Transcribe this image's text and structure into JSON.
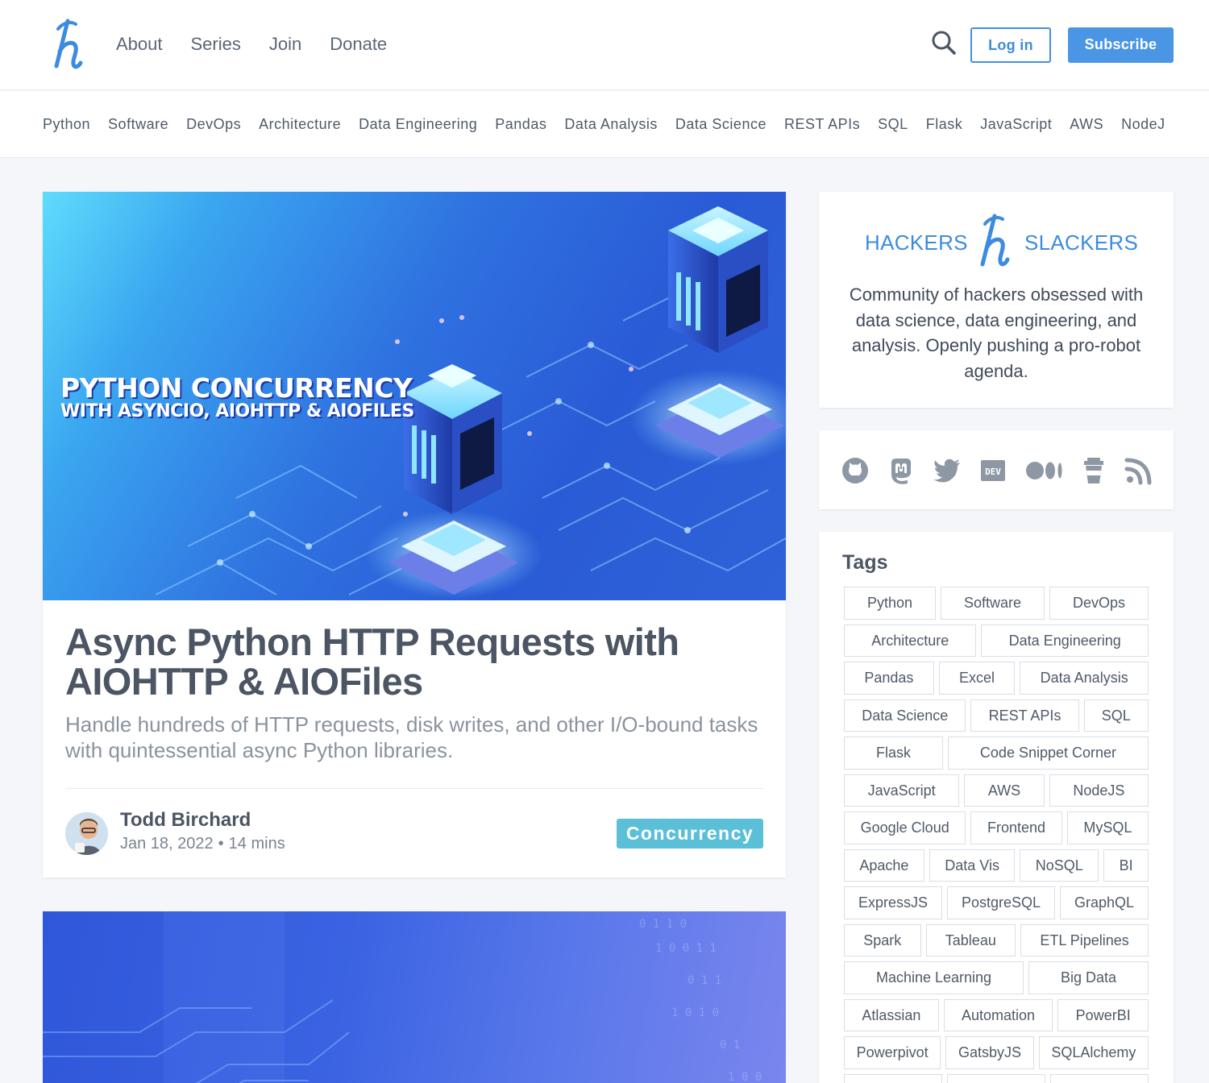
{
  "header": {
    "nav": [
      "About",
      "Series",
      "Join",
      "Donate"
    ],
    "login_label": "Log in",
    "subscribe_label": "Subscribe",
    "accent_color": "#4a96e4"
  },
  "tagbar": [
    "Python",
    "Software",
    "DevOps",
    "Architecture",
    "Data Engineering",
    "Pandas",
    "Data Analysis",
    "Data Science",
    "REST APIs",
    "SQL",
    "Flask",
    "JavaScript",
    "AWS",
    "NodeJ"
  ],
  "featured": {
    "hero_title": "PYTHON CONCURRENCY",
    "hero_subtitle": "WITH ASYNCIO, AIOHTTP & AIOFILES",
    "title": "Async Python HTTP Requests with AIOHTTP & AIOFiles",
    "description": "Handle hundreds of HTTP requests, disk writes, and other I/O-bound tasks with quintessential async Python libraries.",
    "author": "Todd Birchard",
    "date": "Jan 18, 2022",
    "separator": "•",
    "read_time": "14 mins",
    "tag": "Concurrency"
  },
  "sidebar": {
    "brand_left": "HACKERS",
    "brand_right": "SLACKERS",
    "about": "Community of hackers obsessed with data science, data engineering, and analysis. Openly pushing a pro-robot agenda.",
    "social_icons": [
      "github-icon",
      "mastodon-icon",
      "twitter-icon",
      "dev-icon",
      "medium-icon",
      "coffee-icon",
      "rss-icon"
    ],
    "dev_label": "DEV",
    "tags_title": "Tags",
    "tag_rows": [
      [
        "Python",
        "Software",
        "DevOps"
      ],
      [
        "Architecture",
        "Data Engineering"
      ],
      [
        "Pandas",
        "Excel",
        "Data Analysis"
      ],
      [
        "Data Science",
        "REST APIs",
        "SQL"
      ],
      [
        "Flask",
        "Code Snippet Corner"
      ],
      [
        "JavaScript",
        "AWS",
        "NodeJS"
      ],
      [
        "Google Cloud",
        "Frontend",
        "MySQL"
      ],
      [
        "Apache",
        "Data Vis",
        "NoSQL",
        "BI"
      ],
      [
        "ExpressJS",
        "PostgreSQL",
        "GraphQL"
      ],
      [
        "Spark",
        "Tableau",
        "ETL Pipelines"
      ],
      [
        "Machine Learning",
        "Big Data"
      ],
      [
        "Atlassian",
        "Automation",
        "PowerBI"
      ],
      [
        "Powerpivot",
        "GatsbyJS",
        "SQLAlchemy"
      ],
      [
        "",
        "",
        ""
      ]
    ]
  }
}
